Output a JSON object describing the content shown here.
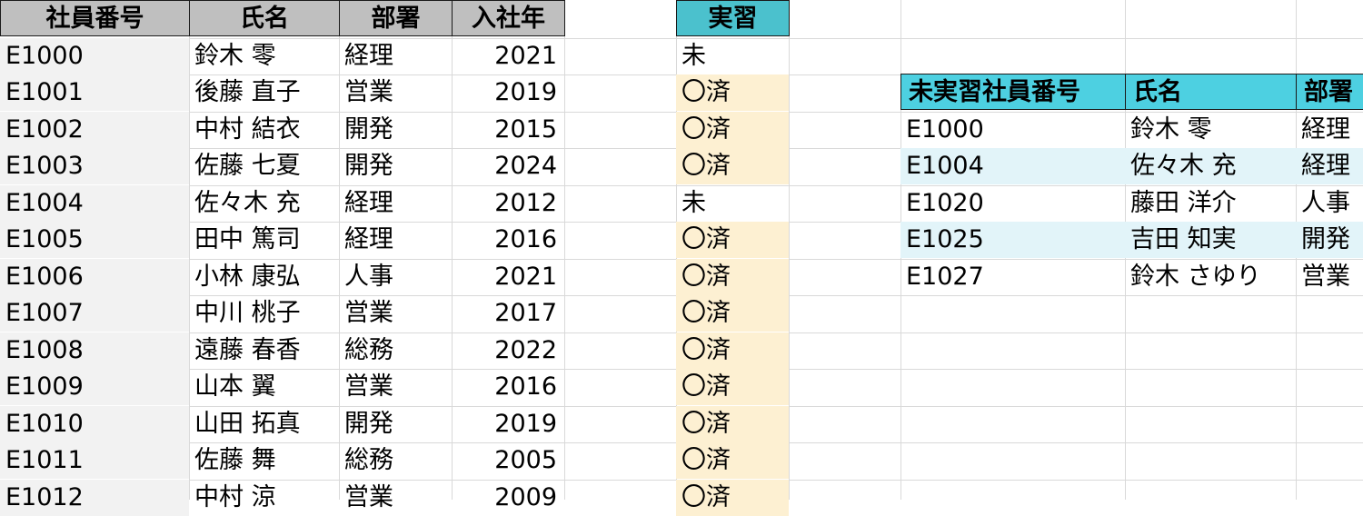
{
  "main_table": {
    "headers": [
      "社員番号",
      "氏名",
      "部署",
      "入社年"
    ],
    "rows": [
      {
        "id": "E1000",
        "name": "鈴木 零",
        "dept": "経理",
        "year": "2021"
      },
      {
        "id": "E1001",
        "name": "後藤 直子",
        "dept": "営業",
        "year": "2019"
      },
      {
        "id": "E1002",
        "name": "中村 結衣",
        "dept": "開発",
        "year": "2015"
      },
      {
        "id": "E1003",
        "name": "佐藤 七夏",
        "dept": "開発",
        "year": "2024"
      },
      {
        "id": "E1004",
        "name": "佐々木 充",
        "dept": "経理",
        "year": "2012"
      },
      {
        "id": "E1005",
        "name": "田中 篤司",
        "dept": "経理",
        "year": "2016"
      },
      {
        "id": "E1006",
        "name": "小林 康弘",
        "dept": "人事",
        "year": "2021"
      },
      {
        "id": "E1007",
        "name": "中川 桃子",
        "dept": "営業",
        "year": "2017"
      },
      {
        "id": "E1008",
        "name": "遠藤 春香",
        "dept": "総務",
        "year": "2022"
      },
      {
        "id": "E1009",
        "name": "山本 翼",
        "dept": "営業",
        "year": "2016"
      },
      {
        "id": "E1010",
        "name": "山田 拓真",
        "dept": "開発",
        "year": "2019"
      },
      {
        "id": "E1011",
        "name": "佐藤 舞",
        "dept": "総務",
        "year": "2005"
      },
      {
        "id": "E1012",
        "name": "中村 涼",
        "dept": "営業",
        "year": "2009"
      }
    ]
  },
  "training": {
    "header": "実習",
    "values": [
      "未",
      "〇済",
      "〇済",
      "〇済",
      "未",
      "〇済",
      "〇済",
      "〇済",
      "〇済",
      "〇済",
      "〇済",
      "〇済",
      "〇済"
    ]
  },
  "untrained_table": {
    "headers": [
      "未実習社員番号",
      "氏名",
      "部署"
    ],
    "rows": [
      {
        "id": "E1000",
        "name": "鈴木 零",
        "dept": "経理"
      },
      {
        "id": "E1004",
        "name": "佐々木 充",
        "dept": "経理"
      },
      {
        "id": "E1020",
        "name": "藤田 洋介",
        "dept": "人事"
      },
      {
        "id": "E1025",
        "name": "吉田 知実",
        "dept": "開発"
      },
      {
        "id": "E1027",
        "name": "鈴木 さゆり",
        "dept": "営業"
      }
    ]
  },
  "colors": {
    "header_gray": "#bfbfbf",
    "header_teal": "#4bc1cd",
    "header_cyan": "#4dd0e1",
    "done_fill": "#fdf0d2",
    "stripe_gray": "#f2f2f2",
    "stripe_cyan": "#e2f4f9"
  }
}
